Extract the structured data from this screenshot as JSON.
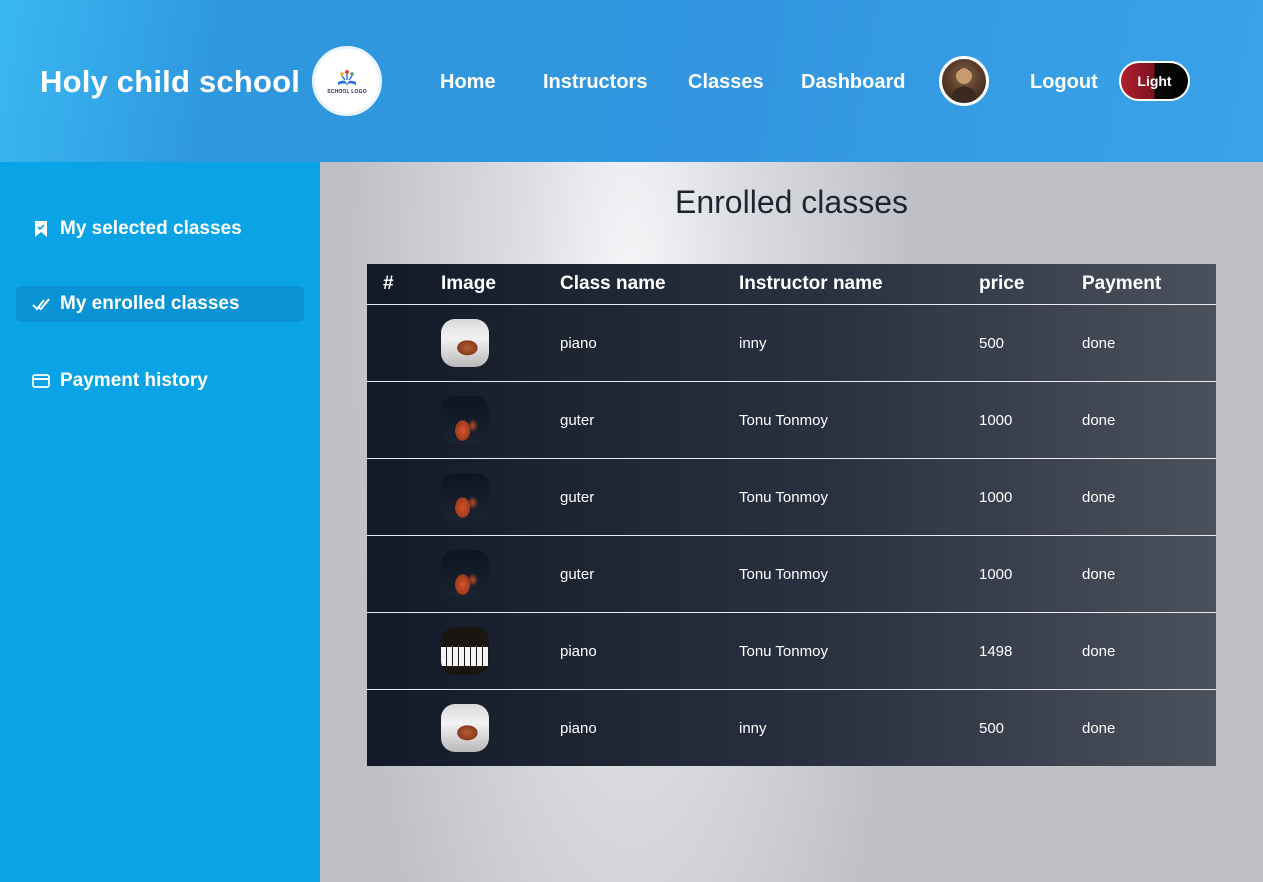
{
  "header": {
    "brand": "Holy child school",
    "logo_text": "SCHOOL LOGO",
    "nav": [
      "Home",
      "Instructors",
      "Classes",
      "Dashboard"
    ],
    "logout": "Logout",
    "theme_toggle": "Light"
  },
  "sidebar": {
    "items": [
      {
        "label": "My selected classes",
        "icon": "bookmark-icon"
      },
      {
        "label": "My enrolled classes",
        "icon": "checkmark-icon",
        "active": true
      },
      {
        "label": "Payment history",
        "icon": "credit-card-icon"
      }
    ]
  },
  "main": {
    "title": "Enrolled classes",
    "table": {
      "columns": [
        "#",
        "Image",
        "Class name",
        "Instructor name",
        "price",
        "Payment"
      ],
      "rows": [
        {
          "image": "piano-photo",
          "class_name": "piano",
          "instructor": "inny",
          "price": "500",
          "payment": "done"
        },
        {
          "image": "guitar-photo",
          "class_name": "guter",
          "instructor": "Tonu Tonmoy",
          "price": "1000",
          "payment": "done"
        },
        {
          "image": "guitar-photo",
          "class_name": "guter",
          "instructor": "Tonu Tonmoy",
          "price": "1000",
          "payment": "done"
        },
        {
          "image": "guitar-photo",
          "class_name": "guter",
          "instructor": "Tonu Tonmoy",
          "price": "1000",
          "payment": "done"
        },
        {
          "image": "piano-keys-photo",
          "class_name": "piano",
          "instructor": "Tonu Tonmoy",
          "price": "1498",
          "payment": "done"
        },
        {
          "image": "piano-photo",
          "class_name": "piano",
          "instructor": "inny",
          "price": "500",
          "payment": "done"
        }
      ]
    }
  },
  "colors": {
    "header_bg": "#3297e0",
    "sidebar_bg": "#0aa3e6",
    "table_bg": "#1c2230"
  }
}
